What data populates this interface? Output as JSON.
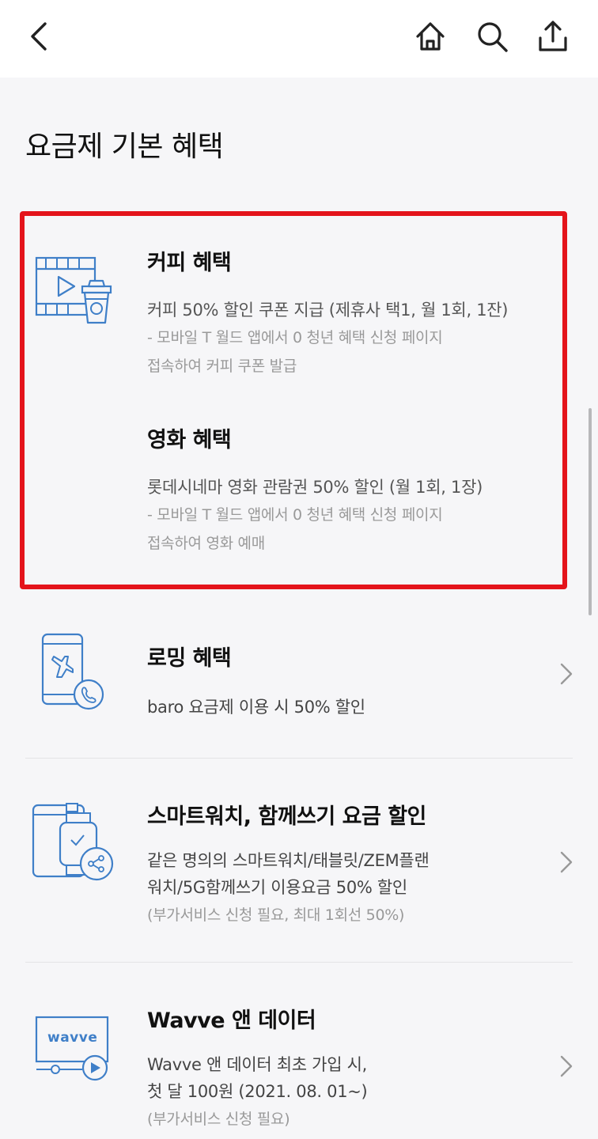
{
  "page_title": "요금제 기본 혜택",
  "colors": {
    "accent": "#3f7fc8",
    "highlight": "#e4141b"
  },
  "benefits": [
    {
      "icon": "video-coffee-icon",
      "title": "커피 혜택",
      "desc": "커피 50% 할인 쿠폰 지급 (제휴사 택1, 월 1회, 1잔)",
      "note_lines": [
        "- 모바일 T 월드 앱에서 0 청년 혜택 신청 페이지",
        "접속하여 커피 쿠폰 발급"
      ]
    },
    {
      "title": "영화 혜택",
      "desc": "롯데시네마 영화 관람권 50% 할인 (월 1회, 1장)",
      "note_lines": [
        "- 모바일 T 월드 앱에서 0 청년 혜택 신청 페이지",
        "접속하여 영화 예매"
      ]
    },
    {
      "icon": "phone-airplane-icon",
      "title": "로밍 혜택",
      "desc_lines": [
        "baro 요금제 이용 시 50% 할인"
      ]
    },
    {
      "icon": "tablet-watch-share-icon",
      "title": "스마트워치, 함께쓰기 요금 할인",
      "desc_lines": [
        "같은 명의의 스마트워치/태블릿/ZEM플랜",
        "워치/5G함께쓰기 이용요금 50% 할인"
      ],
      "note": "(부가서비스 신청 필요, 최대 1회선 50%)"
    },
    {
      "icon": "wavve-monitor-icon",
      "icon_text": "wavve",
      "title": "Wavve 앤 데이터",
      "desc_lines": [
        "Wavve 앤 데이터 최초 가입 시,",
        "첫 달 100원 (2021. 08. 01~)"
      ],
      "note": "(부가서비스 신청 필요)"
    }
  ]
}
